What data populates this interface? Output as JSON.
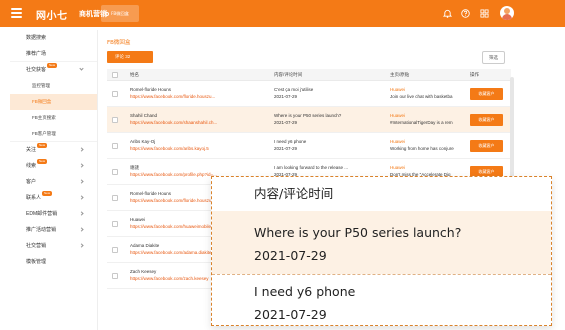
{
  "topbar": {
    "brand": "网小七",
    "product": "商机营销",
    "tab_label": "FB微回盒",
    "icons": [
      "menu-icon",
      "bell-icon",
      "help-icon",
      "grid-icon",
      "avatar"
    ]
  },
  "sidebar": {
    "items": [
      {
        "label": "数据搜索"
      },
      {
        "label": "推荐广场"
      },
      {
        "label": "社交获客",
        "badge": "New",
        "chevron": "down"
      },
      {
        "label": "监控管理",
        "sub": true
      },
      {
        "label": "FB微回盒",
        "sub": true,
        "active": true
      },
      {
        "label": "FB主页搜索",
        "sub": true
      },
      {
        "label": "FB客户管理",
        "sub": true
      },
      {
        "label": "关注",
        "badge": "New",
        "chevron": "right"
      },
      {
        "label": "线索",
        "badge": "New",
        "chevron": "right"
      },
      {
        "label": "客户",
        "chevron": "right"
      },
      {
        "label": "联系人",
        "badge": "New",
        "chevron": "right"
      },
      {
        "label": "EDM邮件营销",
        "chevron": "right"
      },
      {
        "label": "推广活动营销",
        "chevron": "right"
      },
      {
        "label": "社交营销",
        "chevron": "right"
      },
      {
        "label": "模板管理"
      }
    ]
  },
  "main": {
    "title": "FB微回盒",
    "comment_button": "评论 32",
    "filter_button": "筛选",
    "columns": {
      "name": "姓名",
      "content": "内容/评论时间",
      "user": "主页/原贴",
      "op": "操作"
    },
    "op_label": "收藏客户",
    "rows": [
      {
        "name": "Romel-floride Houns",
        "url": "https://www.facebook.com/floride.houszu...",
        "content": "C'est ça moi j'utilise",
        "date": "2021-07-29",
        "user": "Huawei",
        "post": "Join our live chat with basketba"
      },
      {
        "name": "Shahil Chand",
        "url": "https://www.facebook.com/shaanshahil.ch...",
        "content": "Where is your P50 series launch?",
        "date": "2021-07-29",
        "user": "Huawei",
        "post": "#InternationalTigerDay is a rem",
        "highlight": true
      },
      {
        "name": "Aribs Kay-Oj",
        "url": "https://www.facebook.com/aribs.kayoj.5",
        "content": "I need y6 phone",
        "date": "2021-07-29",
        "user": "Huawei",
        "post": "Working from home has conjure"
      },
      {
        "name": "谢謎",
        "url": "https://www.facebook.com/profile.php?id=...",
        "content": "I am looking forward to the release ...",
        "date": "2021-07-29",
        "user": "Huawei",
        "post": "Don't miss the \"Accelerate Dig"
      },
      {
        "name": "Romel-floride Houns",
        "url": "https://www.facebook.com/floride.houszu...",
        "content": "",
        "date": "",
        "user": "",
        "post": "",
        "empty": true
      },
      {
        "name": "Huawei",
        "url": "https://www.facebook.com/huaweimobile",
        "content": "",
        "date": "",
        "user": "",
        "post": "",
        "empty": true
      },
      {
        "name": "Adama Diakite",
        "url": "https://www.facebook.com/adama.diakite...",
        "content": "",
        "date": "",
        "user": "",
        "post": "",
        "empty": true
      },
      {
        "name": "Zach Keesey",
        "url": "https://www.facebook.com/zach.keesey",
        "content": "",
        "date": "",
        "user": "",
        "post": "",
        "empty": true
      }
    ]
  },
  "zoom": {
    "header": "内容/评论时间",
    "rows": [
      {
        "content": "Where is your P50 series launch?",
        "date": "2021-07-29"
      },
      {
        "content": "I need y6 phone",
        "date": "2021-07-29"
      }
    ]
  },
  "colors": {
    "accent": "#f47a16",
    "highlight": "#fdf1e4",
    "link": "#e8570e"
  }
}
